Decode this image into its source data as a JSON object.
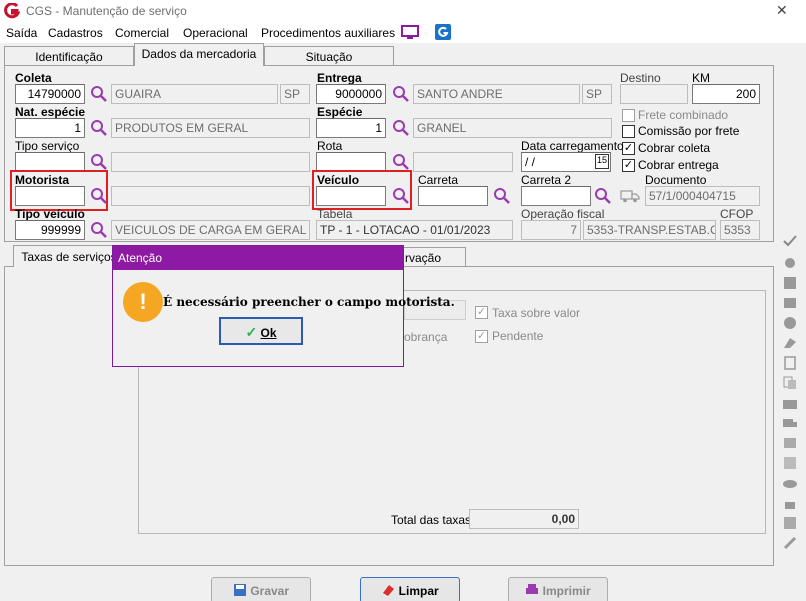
{
  "window": {
    "title": "CGS - Manutenção de serviço",
    "close_label": "✕"
  },
  "menu": [
    "Saída",
    "Cadastros",
    "Comercial",
    "Operacional",
    "Procedimentos auxiliares"
  ],
  "tabs": [
    "Identificação",
    "Dados da mercadoria",
    "Situação"
  ],
  "form": {
    "coleta_label": "Coleta",
    "coleta_value": "14790000",
    "coleta_city": "GUAIRA",
    "coleta_uf": "SP",
    "entrega_label": "Entrega",
    "entrega_value": "9000000",
    "entrega_city": "SANTO ANDRE",
    "entrega_uf": "SP",
    "destino_label": "Destino",
    "km_label": "KM",
    "km_value": "200",
    "nat_label": "Nat. espécie",
    "nat_value": "1",
    "nat_desc": "PRODUTOS EM GERAL",
    "especie_label": "Espécie",
    "especie_value": "1",
    "especie_desc": "GRANEL",
    "frete_combinado": "Frete combinado",
    "comissao": "Comissão por frete",
    "cobrar_coleta": "Cobrar coleta",
    "cobrar_entrega": "Cobrar entrega",
    "tipo_servico_label": "Tipo serviço",
    "rota_label": "Rota",
    "data_carregamento_label": "Data carregamento",
    "data_carregamento_value": " /  /",
    "calendar_label": "15",
    "motorista_label": "Motorista",
    "veiculo_label": "Veículo",
    "carreta_label": "Carreta",
    "carreta2_label": "Carreta 2",
    "documento_label": "Documento",
    "documento_value": "57/1/000404715",
    "tipo_veiculo_label": "Tipo veículo",
    "tipo_veiculo_value": "999999",
    "tipo_veiculo_desc": "VEICULOS DE CARGA EM GERAL",
    "tabela_label": "Tabela",
    "tabela_value": "TP - 1 - LOTACAO - 01/01/2023",
    "operacao_label": "Operação fiscal",
    "operacao_value": "7",
    "operacao_desc": "5353-TRANSP.ESTAB.CO",
    "cfop_label": "CFOP",
    "cfop_value": "5353"
  },
  "lower_tabs": [
    "Taxas de serviços",
    "rvação"
  ],
  "lower": {
    "taxa_sobre_valor": "Taxa sobre valor",
    "cobranca": "obrança",
    "pendente": "Pendente",
    "total_label": "Total das taxas",
    "total_value": "0,00"
  },
  "dialog": {
    "title": "Atenção",
    "message": "É necessário preencher o campo motorista.",
    "ok_label": "Ok",
    "icon": "!"
  },
  "buttons": {
    "gravar": "Gravar",
    "limpar": "Limpar",
    "imprimir": "Imprimir"
  },
  "colors": {
    "accent": "#8e1aa3",
    "highlight": "#e02020",
    "brand": "#c8102e"
  }
}
